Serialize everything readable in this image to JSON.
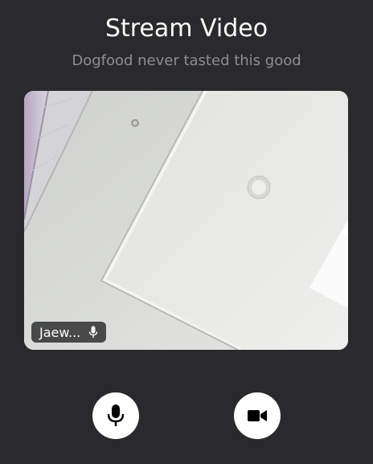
{
  "header": {
    "title": "Stream Video",
    "subtitle": "Dogfood never tasted this good"
  },
  "participant": {
    "name": "Jaew...",
    "mic_state": "on"
  },
  "controls": {
    "microphone": {
      "icon": "microphone-icon",
      "state": "on"
    },
    "camera": {
      "icon": "video-camera-icon",
      "state": "on"
    }
  },
  "colors": {
    "background": "#2a2a2c",
    "title": "#ffffff",
    "subtitle": "#8e8e93",
    "control_button": "#ffffff",
    "control_icon": "#000000"
  }
}
